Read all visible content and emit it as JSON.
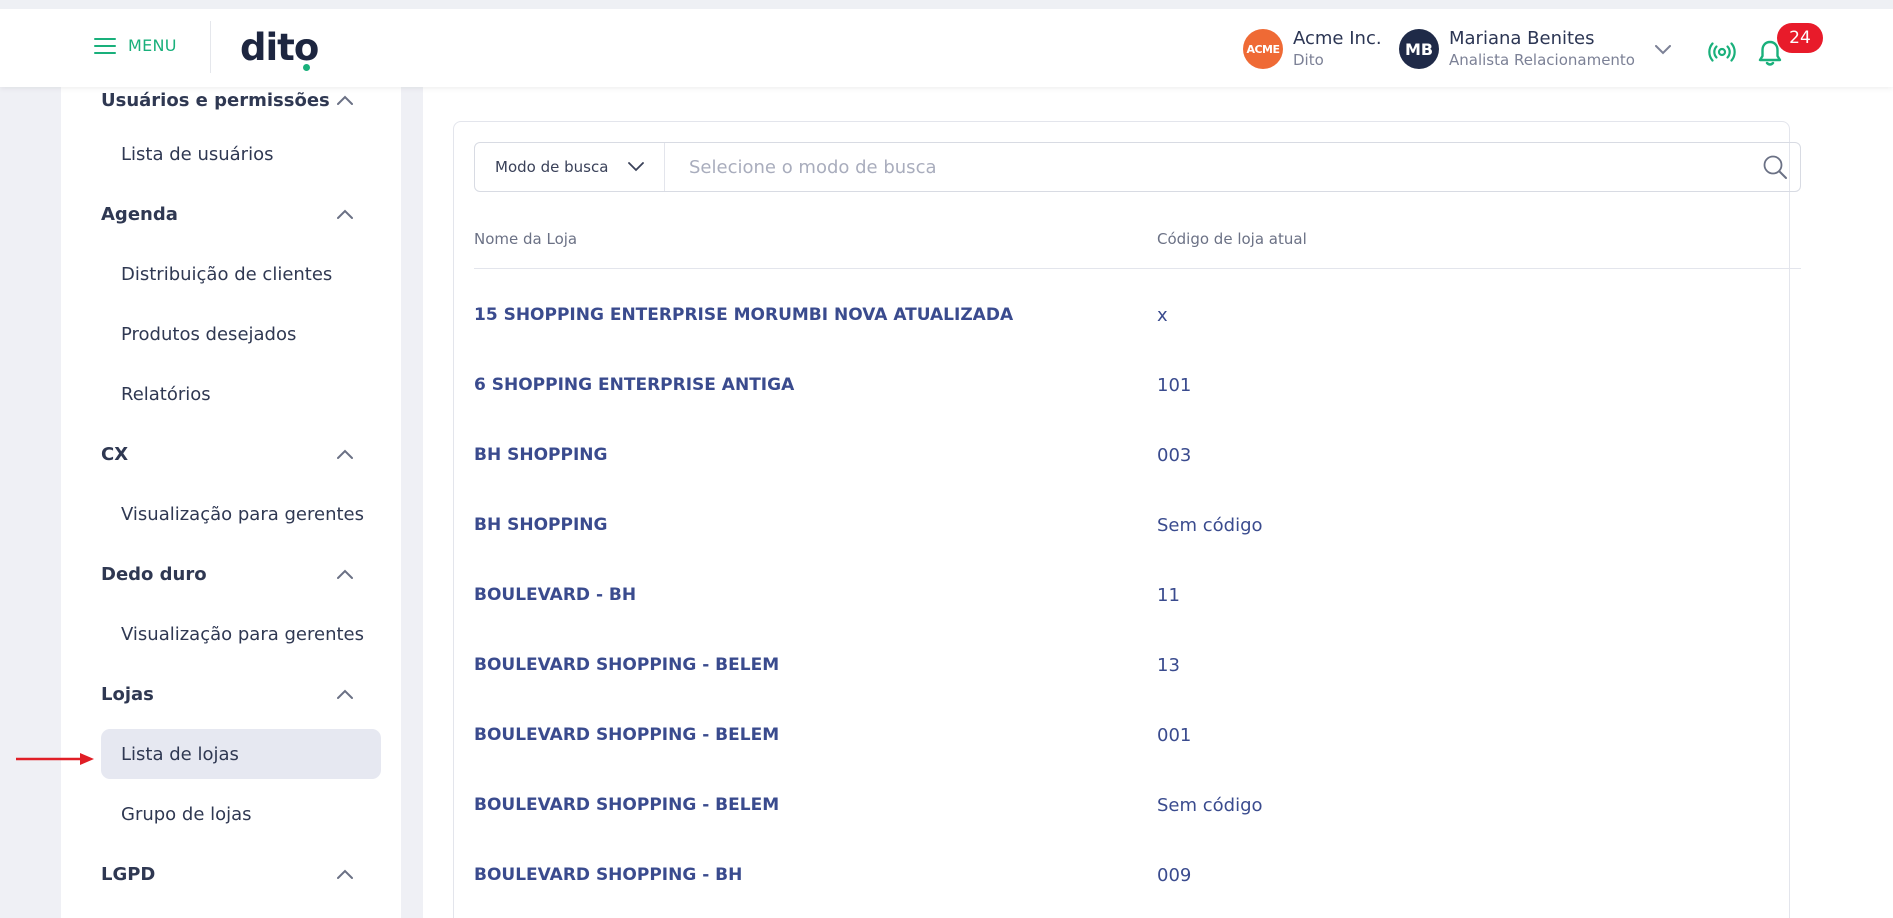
{
  "header": {
    "menu_label": "MENU",
    "logo_text_1": "dit",
    "logo_text_2": "o",
    "org": {
      "badge": "ACME",
      "name": "Acme Inc.",
      "sub": "Dito"
    },
    "user": {
      "initials": "MB",
      "name": "Mariana Benites",
      "role": "Analista Relacionamento"
    },
    "notifications_count": "24",
    "colors": {
      "accent": "#19b07b",
      "alert": "#e81b2a",
      "org_badge": "#ef6a35",
      "user_badge": "#1f2a48"
    }
  },
  "sidebar": {
    "sections": [
      {
        "label": "Usuários e permissões",
        "items": [
          "Lista de usuários"
        ]
      },
      {
        "label": "Agenda",
        "items": [
          "Distribuição de clientes",
          "Produtos desejados",
          "Relatórios"
        ]
      },
      {
        "label": "CX",
        "items": [
          "Visualização para gerentes"
        ]
      },
      {
        "label": "Dedo duro",
        "items": [
          "Visualização para gerentes"
        ]
      },
      {
        "label": "Lojas",
        "items": [
          "Lista de lojas",
          "Grupo de lojas"
        ]
      },
      {
        "label": "LGPD",
        "items": []
      }
    ],
    "active_item": "Lista de lojas"
  },
  "search": {
    "mode_label": "Modo de busca",
    "placeholder": "Selecione o modo de busca",
    "value": ""
  },
  "table": {
    "columns": [
      "Nome da Loja",
      "Código de loja atual"
    ],
    "rows": [
      {
        "name": "15 SHOPPING ENTERPRISE MORUMBI NOVA ATUALIZADA",
        "code": "x"
      },
      {
        "name": "6 SHOPPING ENTERPRISE ANTIGA",
        "code": "101"
      },
      {
        "name": "BH SHOPPING",
        "code": "003"
      },
      {
        "name": "BH SHOPPING",
        "code": "Sem código"
      },
      {
        "name": "BOULEVARD - BH",
        "code": "11"
      },
      {
        "name": "BOULEVARD SHOPPING - BELEM",
        "code": "13"
      },
      {
        "name": "BOULEVARD SHOPPING - BELEM",
        "code": "001"
      },
      {
        "name": "BOULEVARD SHOPPING - BELEM",
        "code": "Sem código"
      },
      {
        "name": "BOULEVARD SHOPPING - BH",
        "code": "009"
      }
    ]
  }
}
